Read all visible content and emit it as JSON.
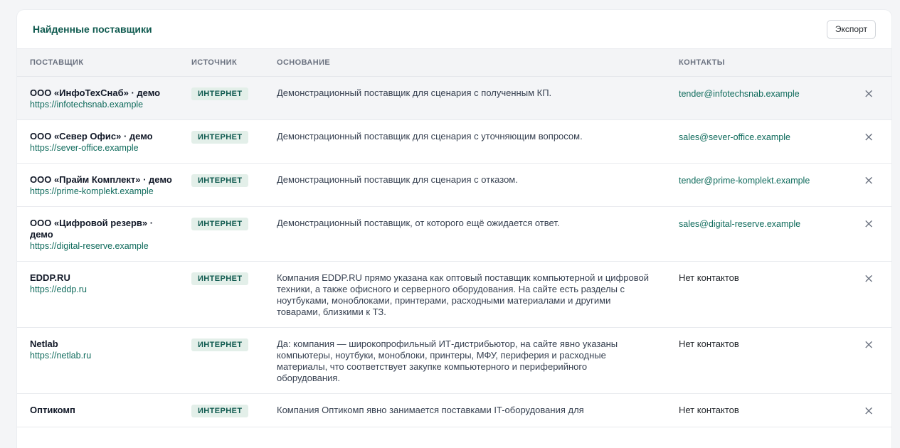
{
  "header": {
    "title": "Найденные поставщики",
    "export_label": "Экспорт"
  },
  "columns": [
    "ПОСТАВЩИК",
    "ИСТОЧНИК",
    "ОСНОВАНИЕ",
    "КОНТАКТЫ"
  ],
  "remove_glyph": "×",
  "rows": [
    {
      "name": "ООО «ИнфоТехСнаб» · демо",
      "url": "https://infotechsnab.example",
      "source": "ИНТЕРНЕТ",
      "reason": "Демонстрационный поставщик для сценария с полученным КП.",
      "contact": "tender@infotechsnab.example",
      "contact_is_link": true,
      "highlight": true
    },
    {
      "name": "ООО «Север Офис» · демо",
      "url": "https://sever-office.example",
      "source": "ИНТЕРНЕТ",
      "reason": "Демонстрационный поставщик для сценария с уточняющим вопросом.",
      "contact": "sales@sever-office.example",
      "contact_is_link": true,
      "highlight": false
    },
    {
      "name": "ООО «Прайм Комплект» · демо",
      "url": "https://prime-komplekt.example",
      "source": "ИНТЕРНЕТ",
      "reason": "Демонстрационный поставщик для сценария с отказом.",
      "contact": "tender@prime-komplekt.example",
      "contact_is_link": true,
      "highlight": false
    },
    {
      "name": "ООО «Цифровой резерв» · демо",
      "url": "https://digital-reserve.example",
      "source": "ИНТЕРНЕТ",
      "reason": "Демонстрационный поставщик, от которого ещё ожидается ответ.",
      "contact": "sales@digital-reserve.example",
      "contact_is_link": true,
      "highlight": false
    },
    {
      "name": "EDDP.RU",
      "url": "https://eddp.ru",
      "source": "ИНТЕРНЕТ",
      "reason": "Компания EDDP.RU прямо указана как оптовый поставщик компьютерной и цифровой техники, а также офисного и серверного оборудования. На сайте есть разделы с ноутбуками, моноблоками, принтерами, расходными материалами и другими товарами, близкими к ТЗ.",
      "contact": "Нет контактов",
      "contact_is_link": false,
      "highlight": false
    },
    {
      "name": "Netlab",
      "url": "https://netlab.ru",
      "source": "ИНТЕРНЕТ",
      "reason": "Да: компания — широкопрофильный ИТ-дистрибьютор, на сайте явно указаны компьютеры, ноутбуки, моноблоки, принтеры, МФУ, периферия и расходные материалы, что соответствует закупке компьютерного и периферийного оборудования.",
      "contact": "Нет контактов",
      "contact_is_link": false,
      "highlight": false
    },
    {
      "name": "Оптикомп",
      "url": "",
      "source": "ИНТЕРНЕТ",
      "reason": "Компания Оптикомп явно занимается поставками IT-оборудования для",
      "contact": "Нет контактов",
      "contact_is_link": false,
      "highlight": false
    }
  ]
}
